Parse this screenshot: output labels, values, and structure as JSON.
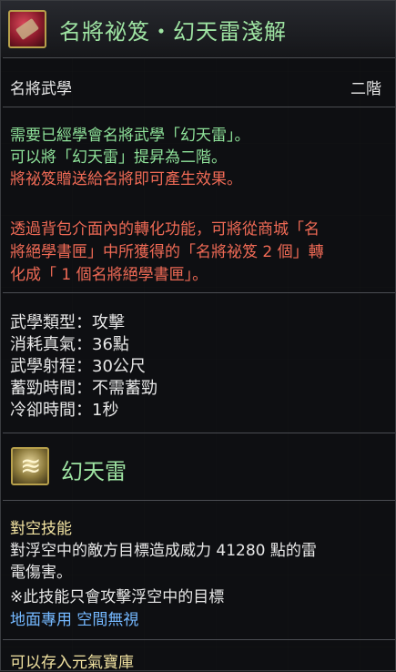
{
  "item": {
    "title": "名將祕笈・幻天雷淺解",
    "category": "名將武學",
    "grade": "二階",
    "requirement_lines": [
      "需要已經學會名將武學「幻天雷」。",
      "可以將「幻天雷」提昇為二階。"
    ],
    "effect_note": "將祕笈贈送給名將即可產生效果。",
    "conversion_lines": [
      "透過背包介面內的轉化功能，可將從商城「名",
      "將絕學書匣」中所獲得的「名將祕笈 2 個」轉",
      "化成「 1 個名將絕學書匣」。"
    ]
  },
  "stats": [
    {
      "label": "武學類型",
      "value": "攻擊"
    },
    {
      "label": "消耗真氣",
      "value": "36點"
    },
    {
      "label": "武學射程",
      "value": "30公尺"
    },
    {
      "label": "蓄勁時間",
      "value": "不需蓄勁"
    },
    {
      "label": "冷卻時間",
      "value": "1秒"
    }
  ],
  "skill": {
    "name": "幻天雷",
    "type": "對空技能",
    "desc_lines": [
      "對浮空中的敵方目標造成威力 41280 點的雷",
      "電傷害。",
      "※此技能只會攻擊浮空中的目標"
    ],
    "tag_ground": "地面專用",
    "tag_space": "空間無視"
  },
  "footer": {
    "storage_note": "可以存入元氣寶庫"
  },
  "colors": {
    "title_green": "#9ee3a2",
    "req_green": "#8fe39a",
    "warn_red": "#ef6a55",
    "highlight_yellow": "#f2e3a1",
    "tag_blue": "#74b8ff"
  },
  "icons": {
    "item": "red-scroll-book-icon",
    "skill": "phantom-thunder-skill-icon"
  }
}
